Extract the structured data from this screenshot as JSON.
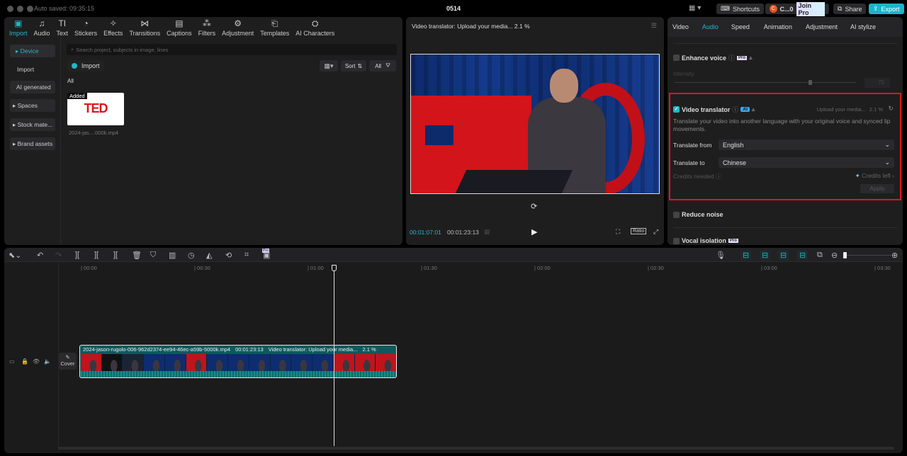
{
  "titlebar": {
    "autosaved": "Auto saved: 09:35:15",
    "project": "0514",
    "shortcuts": "Shortcuts",
    "account": "C...0",
    "join_pro": "Join Pro",
    "share": "Share",
    "export": "Export"
  },
  "toolbar_tabs": [
    {
      "label": "Import",
      "icon": "import-icon"
    },
    {
      "label": "Audio",
      "icon": "audio-icon"
    },
    {
      "label": "Text",
      "icon": "text-icon"
    },
    {
      "label": "Stickers",
      "icon": "sticker-icon"
    },
    {
      "label": "Effects",
      "icon": "effects-icon"
    },
    {
      "label": "Transitions",
      "icon": "transitions-icon"
    },
    {
      "label": "Captions",
      "icon": "captions-icon"
    },
    {
      "label": "Filters",
      "icon": "filters-icon"
    },
    {
      "label": "Adjustment",
      "icon": "adjustment-icon"
    },
    {
      "label": "Templates",
      "icon": "templates-icon"
    },
    {
      "label": "AI Characters",
      "icon": "ai-characters-icon"
    }
  ],
  "sidebar": {
    "items": [
      "▸ Device",
      "Import",
      "AI generated",
      "▸ Spaces",
      "▸ Stock mate...",
      "▸ Brand assets"
    ]
  },
  "media": {
    "search_placeholder": "Search project, subjects in image, lines",
    "import": "Import",
    "sort": "Sort",
    "all_filter": "All",
    "section": "All",
    "item": {
      "badge": "Added",
      "thumb_text": "TED",
      "name": "2024-jas....000k.mp4"
    }
  },
  "player": {
    "title": "Video translator: Upload your media...  2.1 %",
    "current": "00:01:07:01",
    "total": "00:01:23:13",
    "ratio": "Ratio"
  },
  "inspector": {
    "tabs": [
      "Video",
      "Audio",
      "Speed",
      "Animation",
      "Adjustment",
      "AI stylize"
    ],
    "active_tab": "Audio",
    "enhance_voice": {
      "label": "Enhance voice",
      "badge": "Pro",
      "intensity_label": "Intensity",
      "intensity_value": "75",
      "intensity_fraction": 0.75
    },
    "video_translator": {
      "label": "Video translator",
      "badge": "AI",
      "status": "Upload your media...",
      "progress": "2.1 %",
      "description": "Translate your video into another language with your original voice and synced lip movements.",
      "from_label": "Translate from",
      "from_value": "English",
      "to_label": "Translate to",
      "to_value": "Chinese",
      "credits_needed": "Credits needed",
      "credits_left": "Credits left",
      "apply": "Apply"
    },
    "reduce_noise": {
      "label": "Reduce noise"
    },
    "vocal_isolation": {
      "label": "Vocal isolation",
      "badge": "Pro"
    }
  },
  "timeline": {
    "ruler": [
      "00:00",
      "00:30",
      "01:00",
      "01:30",
      "02:00",
      "02:30",
      "03:00",
      "03:30"
    ],
    "cover": "Cover",
    "clip": {
      "name": "2024-jason-rugolo-006-962d2374-ee94-46ec-a59b-5000k.mp4",
      "duration": "00:01:23:13",
      "status": "Video translator: Upload your media...",
      "progress": "2.1 %"
    },
    "pro_badge": "Pro"
  },
  "colors": {
    "accent": "#1fb8c8",
    "highlight": "#e0161b",
    "export": "#17b6c9"
  }
}
